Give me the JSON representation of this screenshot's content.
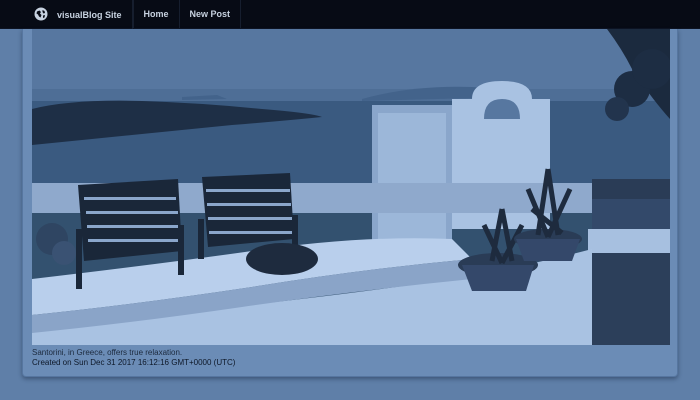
{
  "navbar": {
    "brand": "visualBlog Site",
    "brand_icon": "globe-icon",
    "items": [
      "Home",
      "New Post"
    ]
  },
  "post": {
    "image_alt": "Santorini terrace with two chairs overlooking the sea",
    "caption": "Santorini, in Greece, offers true relaxation.",
    "created": "Created on Sun Dec 31 2017 16:12:16 GMT+0000 (UTC)"
  },
  "colors": {
    "navbar": "#070b15",
    "background": "#5f7fa8",
    "card": "#6b8cb6"
  }
}
